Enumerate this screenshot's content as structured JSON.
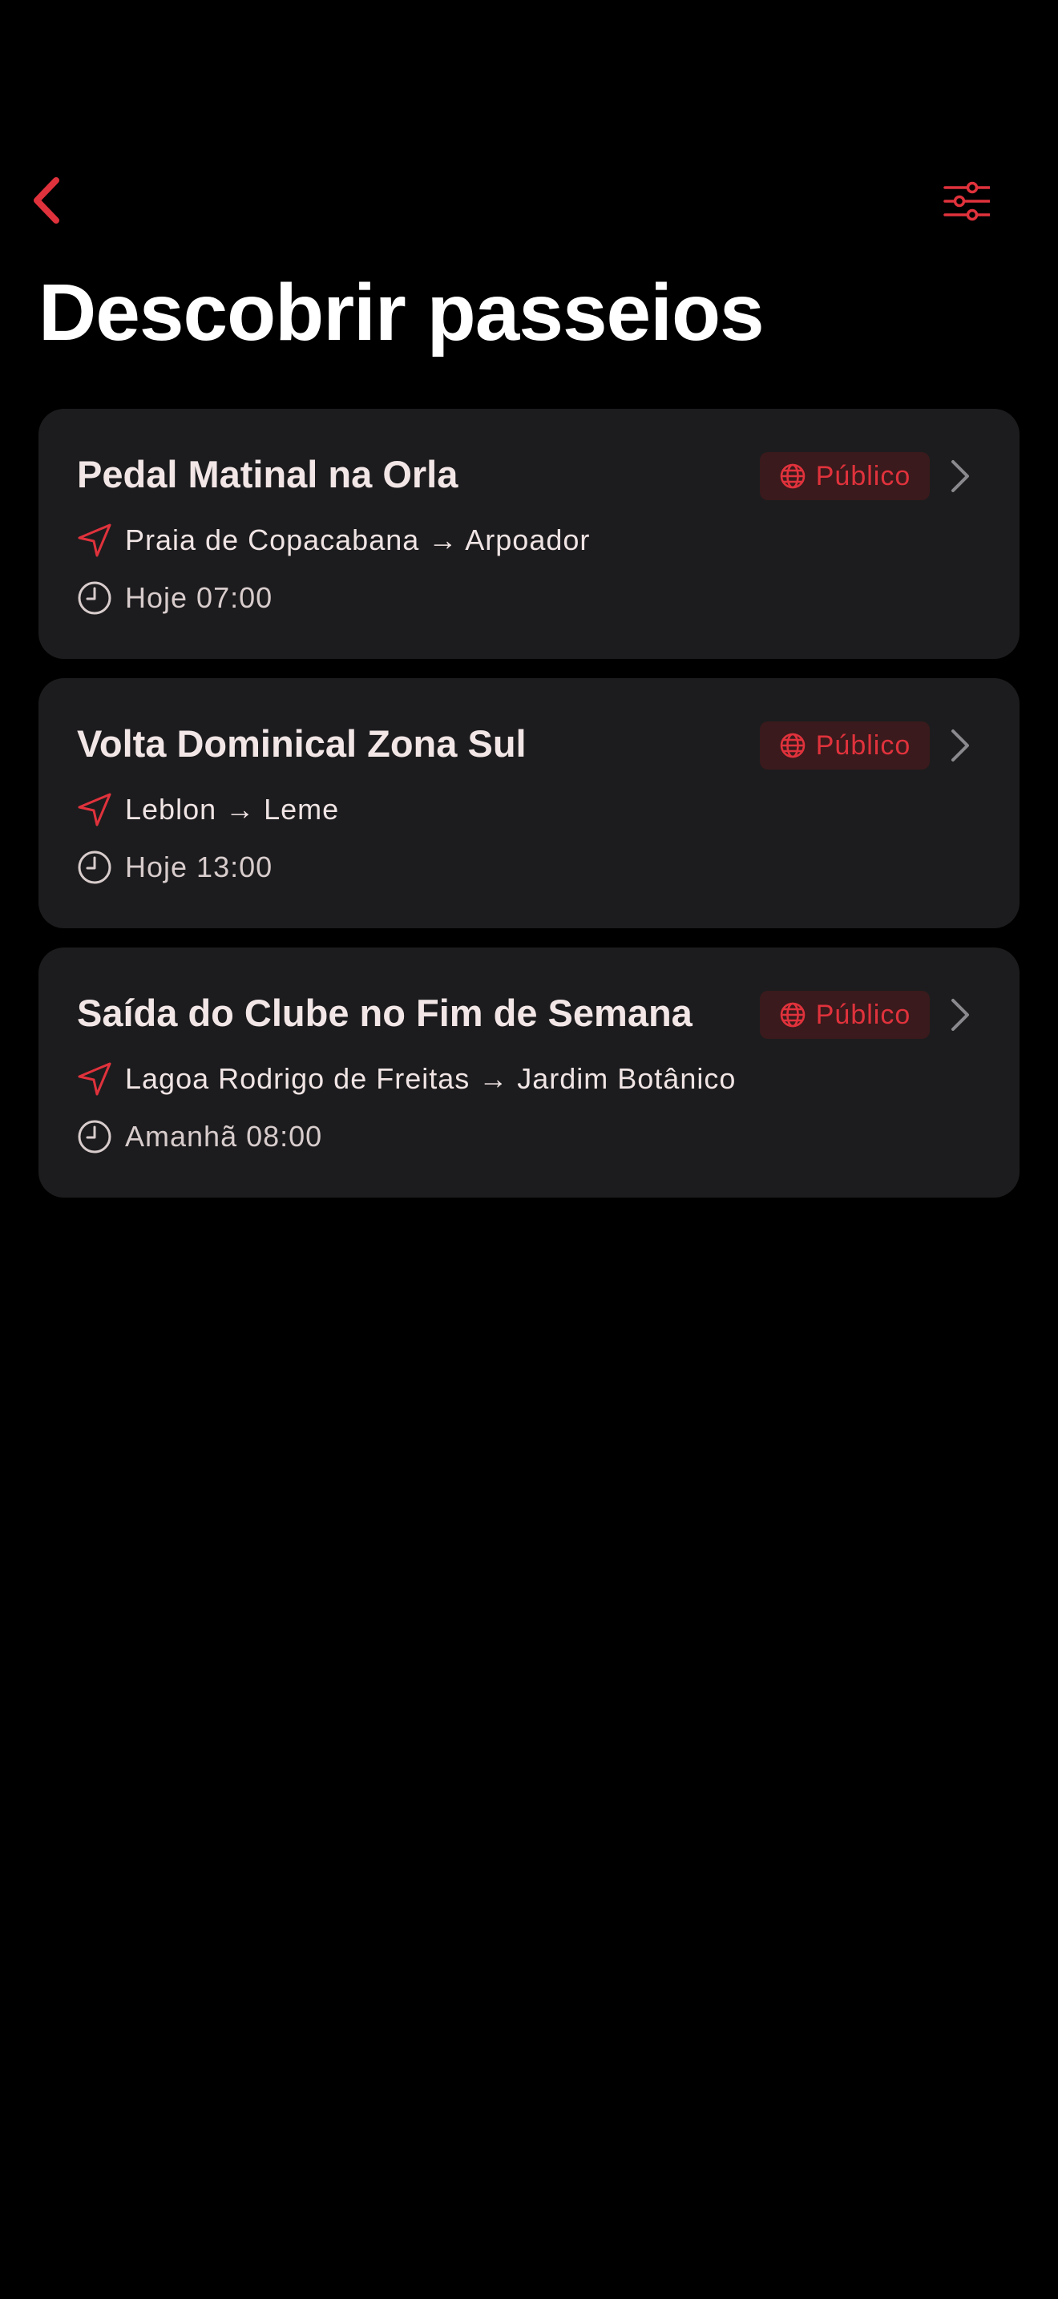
{
  "header": {
    "title": "Descobrir passeios"
  },
  "colors": {
    "accent": "#e0323c",
    "card_background": "#1c1c1e",
    "badge_background": "#3a1a1c",
    "text_primary": "#f2e6e6",
    "background": "#000000"
  },
  "icons": {
    "back": "chevron-left-icon",
    "filter": "sliders-icon",
    "badge": "globe-icon",
    "route": "navigation-arrow-icon",
    "time": "clock-icon",
    "open": "chevron-right-icon"
  },
  "rides": [
    {
      "title": "Pedal Matinal na Orla",
      "visibility": "Público",
      "route": "Praia de Copacabana → Arpoador",
      "time": "Hoje 07:00"
    },
    {
      "title": "Volta Dominical Zona Sul",
      "visibility": "Público",
      "route": "Leblon → Leme",
      "time": "Hoje 13:00"
    },
    {
      "title": "Saída do Clube no Fim de Semana",
      "visibility": "Público",
      "route": "Lagoa Rodrigo de Freitas → Jardim Botânico",
      "time": "Amanhã 08:00"
    }
  ]
}
